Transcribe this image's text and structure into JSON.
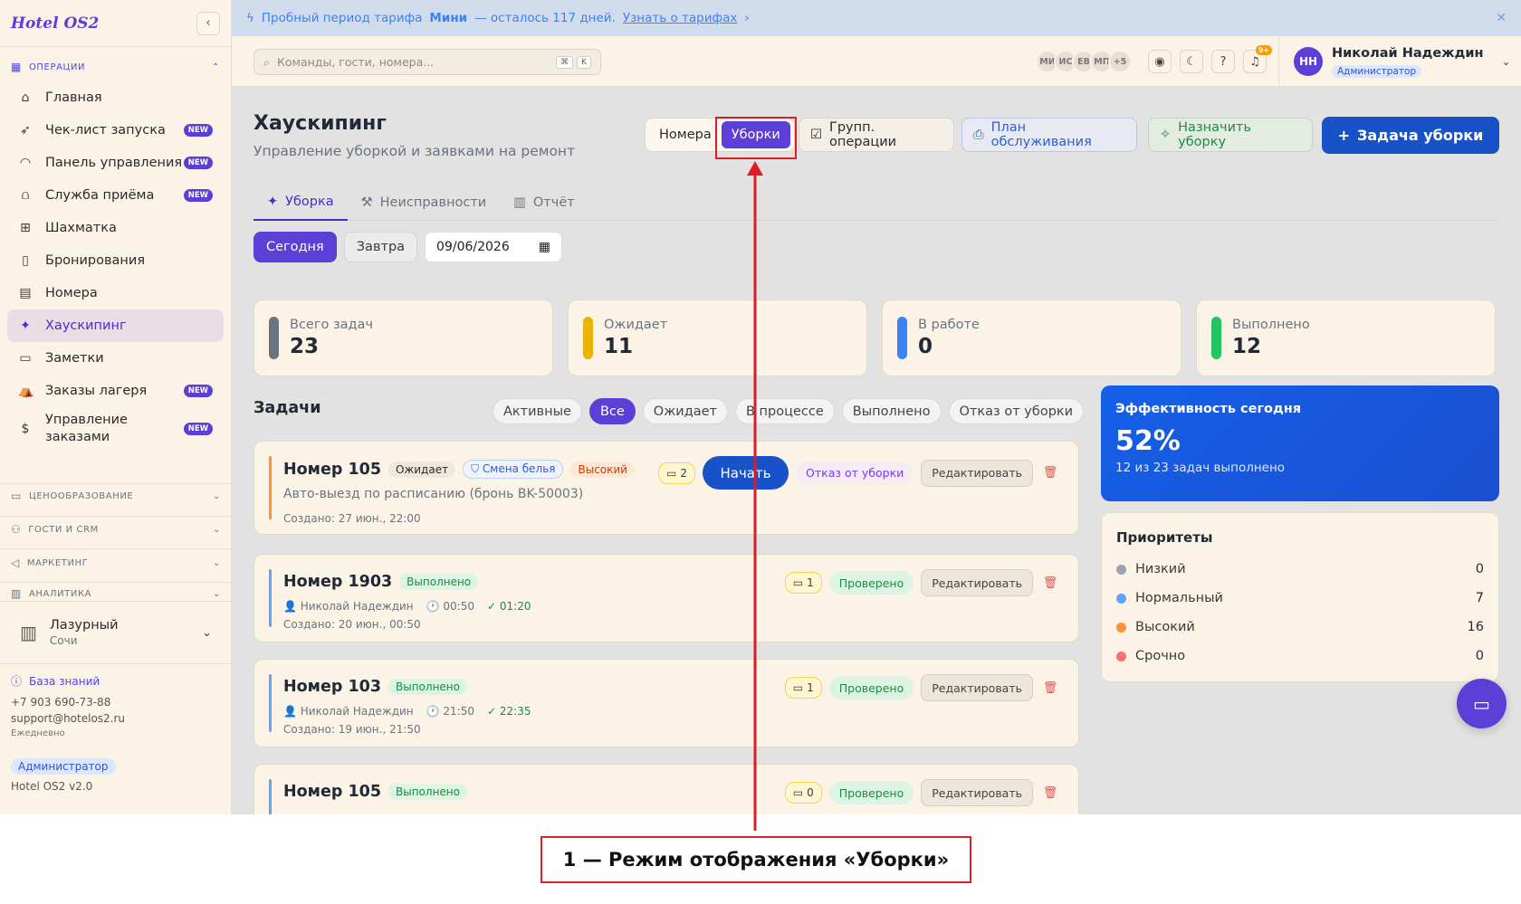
{
  "sidebar": {
    "brand": "Hotel OS2",
    "section_ops": "ОПЕРАЦИИ",
    "items": [
      {
        "label": "Главная",
        "badge": ""
      },
      {
        "label": "Чек-лист запуска",
        "badge": "NEW"
      },
      {
        "label": "Панель управления",
        "badge": "NEW"
      },
      {
        "label": "Служба приёма",
        "badge": "NEW"
      },
      {
        "label": "Шахматка",
        "badge": ""
      },
      {
        "label": "Бронирования",
        "badge": ""
      },
      {
        "label": "Номера",
        "badge": ""
      },
      {
        "label": "Хаускипинг",
        "badge": ""
      },
      {
        "label": "Заметки",
        "badge": ""
      },
      {
        "label": "Заказы лагеря",
        "badge": "NEW"
      },
      {
        "label": "Управление заказами",
        "badge": "NEW"
      }
    ],
    "sections": [
      "ЦЕНООБРАЗОВАНИЕ",
      "ГОСТИ И CRM",
      "МАРКЕТИНГ",
      "АНАЛИТИКА"
    ],
    "hotel_name": "Лазурный",
    "hotel_city": "Сочи",
    "kb_label": "База знаний",
    "phone": "+7 903 690-73-88",
    "email": "support@hotelos2.ru",
    "schedule": "Ежедневно",
    "role": "Администратор",
    "version": "Hotel OS2 v2.0"
  },
  "banner": {
    "text_before": "Пробный период тарифа",
    "plan": "Мини",
    "text_after": "— осталось 117 дней.",
    "link": "Узнать о тарифах"
  },
  "topbar": {
    "search_placeholder": "Команды, гости, номера...",
    "kbd1": "⌘",
    "kbd2": "K",
    "avatars": [
      "МИ",
      "ИС",
      "ЕВ",
      "МП",
      "+5"
    ],
    "notif_count": "9+",
    "user_initials": "НН",
    "user_name": "Николай Надеждин",
    "user_role": "Администратор"
  },
  "page": {
    "title": "Хаускипинг",
    "subtitle": "Управление уборкой и заявками на ремонт",
    "view_rooms": "Номера",
    "view_cleanings": "Уборки",
    "btn_group": "Групп. операции",
    "btn_plan": "План обслуживания",
    "btn_assign": "Назначить уборку",
    "btn_task": "Задача уборки",
    "tabs": [
      "Уборка",
      "Неисправности",
      "Отчёт"
    ],
    "date_today": "Сегодня",
    "date_tomorrow": "Завтра",
    "date_value": "09/06/2026"
  },
  "stats": [
    {
      "label": "Всего задач",
      "value": "23",
      "color": "#6b7280"
    },
    {
      "label": "Ожидает",
      "value": "11",
      "color": "#eab308"
    },
    {
      "label": "В работе",
      "value": "0",
      "color": "#3b82f6"
    },
    {
      "label": "Выполнено",
      "value": "12",
      "color": "#22c55e"
    }
  ],
  "tasks": {
    "heading": "Задачи",
    "filters": [
      "Активные",
      "Все",
      "Ожидает",
      "В процессе",
      "Выполнено",
      "Отказ от уборки"
    ],
    "cards": [
      {
        "room": "Номер 105",
        "status": "Ожидает",
        "tag": "Смена белья",
        "priority": "Высокий",
        "desc": "Авто-выезд по расписанию (бронь BK-50003)",
        "created": "Создано: 27 июн., 22:00",
        "comments": "2",
        "start": "Начать",
        "refuse": "Отказ от уборки",
        "edit": "Редактировать"
      },
      {
        "room": "Номер 1903",
        "status": "Выполнено",
        "assignee": "Николай Надеждин",
        "time": "00:50",
        "done_time": "✓ 01:20",
        "created": "Создано: 20 июн., 00:50",
        "comments": "1",
        "checked": "Проверено",
        "edit": "Редактировать"
      },
      {
        "room": "Номер 103",
        "status": "Выполнено",
        "assignee": "Николай Надеждин",
        "time": "21:50",
        "done_time": "✓ 22:35",
        "created": "Создано: 19 июн., 21:50",
        "comments": "1",
        "checked": "Проверено",
        "edit": "Редактировать"
      },
      {
        "room": "Номер 105",
        "status": "Выполнено",
        "comments": "0",
        "checked": "Проверено",
        "edit": "Редактировать"
      }
    ]
  },
  "efficiency": {
    "title": "Эффективность сегодня",
    "value": "52%",
    "sub": "12 из 23 задач выполнено"
  },
  "priorities": {
    "title": "Приоритеты",
    "rows": [
      {
        "label": "Низкий",
        "value": "0",
        "color": "#9ca3af"
      },
      {
        "label": "Нормальный",
        "value": "7",
        "color": "#60a5fa"
      },
      {
        "label": "Высокий",
        "value": "16",
        "color": "#fb923c"
      },
      {
        "label": "Срочно",
        "value": "0",
        "color": "#f87171"
      }
    ]
  },
  "annotation": {
    "label": "1 — Режим отображения «Уборки»"
  }
}
